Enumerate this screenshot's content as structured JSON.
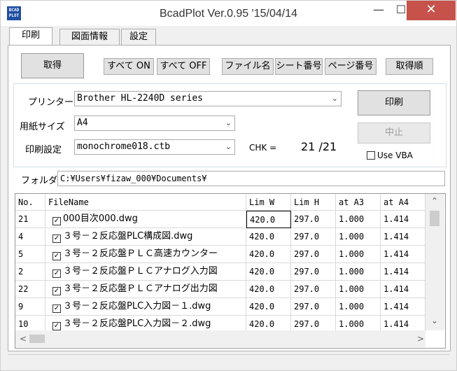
{
  "window": {
    "title": "BcadPlot Ver.0.95 '15/04/14",
    "icon_text": "BCAD PLOT",
    "min": "—",
    "max": "☐",
    "close": "✕"
  },
  "tabs": [
    "印刷",
    "図面情報",
    "設定"
  ],
  "toolbar": {
    "get": "取得",
    "all_on": "すべて ON",
    "all_off": "すべて OFF",
    "filename": "ファイル名",
    "sheet_no": "シート番号",
    "page_no": "ページ番号",
    "get_order": "取得順"
  },
  "settings": {
    "printer_label": "プリンター",
    "printer_value": "Brother HL-2240D series",
    "paper_label": "用紙サイズ",
    "paper_value": "A4",
    "print_setting_label": "印刷設定",
    "print_setting_value": "monochrome018.ctb",
    "chk_label": "CHK =",
    "chk_value": "21 /21",
    "print_button": "印刷",
    "stop_button": "中止",
    "use_vba_label": "Use VBA"
  },
  "folder": {
    "label": "フォルダ",
    "value": "C:¥Users¥fizaw_000¥Documents¥"
  },
  "grid": {
    "columns": [
      "No.",
      "FileName",
      "Lim W",
      "Lim H",
      "at A3",
      "at A4"
    ],
    "rows": [
      {
        "no": "21",
        "file": "000目次000.dwg",
        "limw": "420.0",
        "limh": "297.0",
        "a3": "1.000",
        "a4": "1.414",
        "checked": true
      },
      {
        "no": "4",
        "file": "３号－２反応盤PLC構成図.dwg",
        "limw": "420.0",
        "limh": "297.0",
        "a3": "1.000",
        "a4": "1.414",
        "checked": true
      },
      {
        "no": "5",
        "file": "３号－２反応盤ＰＬＣ高速カウンター",
        "limw": "420.0",
        "limh": "297.0",
        "a3": "1.000",
        "a4": "1.414",
        "checked": true
      },
      {
        "no": "2",
        "file": "３号－２反応盤ＰＬＣアナログ入力図",
        "limw": "420.0",
        "limh": "297.0",
        "a3": "1.000",
        "a4": "1.414",
        "checked": true
      },
      {
        "no": "22",
        "file": "３号－２反応盤ＰＬＣアナログ出力図",
        "limw": "420.0",
        "limh": "297.0",
        "a3": "1.000",
        "a4": "1.414",
        "checked": true
      },
      {
        "no": "9",
        "file": "３号－２反応盤PLC入力図－１.dwg",
        "limw": "420.0",
        "limh": "297.0",
        "a3": "1.000",
        "a4": "1.414",
        "checked": true
      },
      {
        "no": "10",
        "file": "３号－２反応盤PLC入力図－２.dwg",
        "limw": "420.0",
        "limh": "297.0",
        "a3": "1.000",
        "a4": "1.414",
        "checked": true
      }
    ]
  },
  "colors": {
    "close_button": "#c7514b",
    "app_icon": "#1f4fa3"
  }
}
